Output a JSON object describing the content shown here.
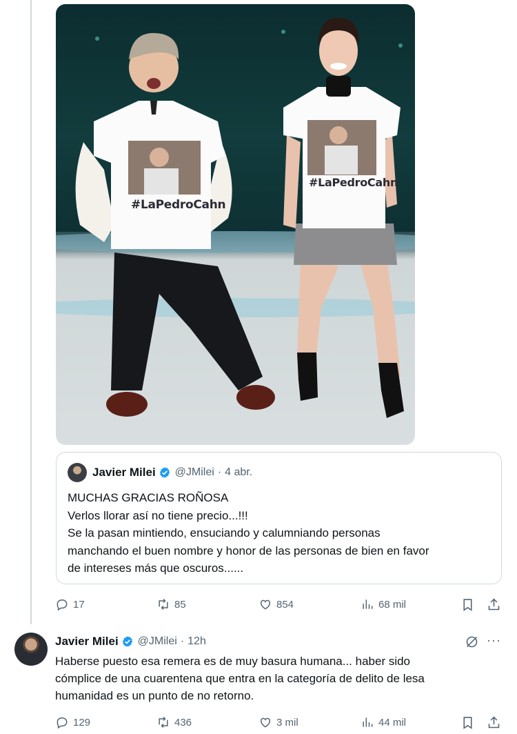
{
  "photo": {
    "shirt_text_left": "#LaPedroCahn",
    "shirt_text_right": "#LaPedroCahn"
  },
  "quote": {
    "author_name": "Javier Milei",
    "author_handle": "@JMilei",
    "separator": "·",
    "time": "4 abr.",
    "lines": [
      "MUCHAS GRACIAS ROÑOSA",
      "Verlos llorar así no tiene precio...!!!",
      "Se la pasan mintiendo, ensuciando y calumniando personas",
      "manchando el buen nombre y honor de las personas de bien en favor",
      "de intereses más que oscuros......"
    ]
  },
  "main_actions": {
    "replies": "17",
    "reposts": "85",
    "likes": "854",
    "views": "68 mil"
  },
  "reply": {
    "author_name": "Javier Milei",
    "author_handle": "@JMilei",
    "separator": "·",
    "time": "12h",
    "more_label": "···",
    "lines": [
      "Haberse puesto esa remera es de muy basura humana... haber sido",
      "cómplice de una cuarentena que entra en la categoría de delito de lesa",
      "humanidad es un punto de no retorno."
    ]
  },
  "reply_actions": {
    "replies": "129",
    "reposts": "436",
    "likes": "3 mil",
    "views": "44 mil"
  },
  "colors": {
    "text": "#0f1419",
    "secondary": "#536471",
    "border": "#cfd9de",
    "verified": "#1d9bf0"
  },
  "icons": [
    "reply-icon",
    "repost-icon",
    "like-icon",
    "views-icon",
    "bookmark-icon",
    "share-icon",
    "verified-icon",
    "grok-icon",
    "more-icon"
  ]
}
